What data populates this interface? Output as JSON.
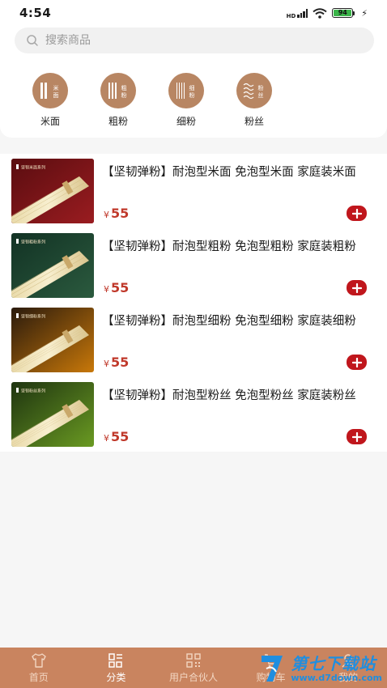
{
  "status_bar": {
    "time": "4:54",
    "hd": "HD",
    "battery": "94"
  },
  "search": {
    "placeholder": "搜索商品"
  },
  "categories": [
    {
      "label": "米面",
      "badge": "米面"
    },
    {
      "label": "粗粉",
      "badge": "粗粉"
    },
    {
      "label": "细粉",
      "badge": "细粉"
    },
    {
      "label": "粉丝",
      "badge": "粉丝"
    }
  ],
  "products": [
    {
      "title": "【坚韧弹粉】耐泡型米面 免泡型米面 家庭装米面",
      "currency": "¥",
      "price": "55",
      "series": "坚韧米面系列"
    },
    {
      "title": "【坚韧弹粉】耐泡型粗粉 免泡型粗粉 家庭装粗粉",
      "currency": "¥",
      "price": "55",
      "series": "坚韧粗粉系列"
    },
    {
      "title": "【坚韧弹粉】耐泡型细粉 免泡型细粉 家庭装细粉",
      "currency": "¥",
      "price": "55",
      "series": "坚韧细粉系列"
    },
    {
      "title": "【坚韧弹粉】耐泡型粉丝 免泡型粉丝 家庭装粉丝",
      "currency": "¥",
      "price": "55",
      "series": "坚韧粉丝系列"
    }
  ],
  "tabs": [
    {
      "label": "首页"
    },
    {
      "label": "分类"
    },
    {
      "label": "用户合伙人"
    },
    {
      "label": "购物车"
    },
    {
      "label": "我的"
    }
  ],
  "watermark": {
    "title": "第七下载站",
    "url": "www.d7down.com"
  },
  "colors": {
    "accent": "#c9845f",
    "category_bg": "#b88663",
    "price": "#c0392b",
    "add_button": "#c0161c",
    "thumb_backgrounds": [
      "#7a1418",
      "#1d3a2c",
      "#3a2410",
      "#2f4a1a"
    ]
  }
}
